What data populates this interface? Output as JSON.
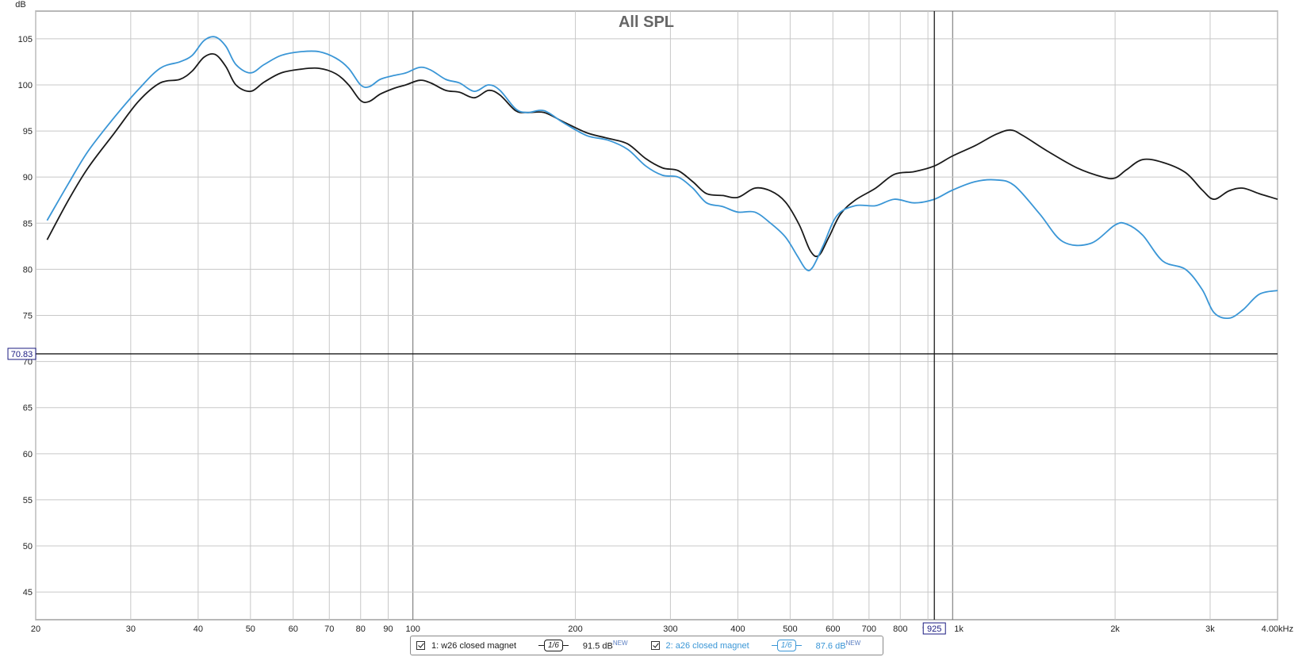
{
  "chart_data": {
    "type": "line",
    "title": "All SPL",
    "ylabel": "dB",
    "xscale": "log",
    "xlim": [
      20,
      4000
    ],
    "ylim": [
      42,
      108
    ],
    "x_ticks": [
      {
        "value": 20,
        "label": "20"
      },
      {
        "value": 30,
        "label": "30"
      },
      {
        "value": 40,
        "label": "40"
      },
      {
        "value": 50,
        "label": "50"
      },
      {
        "value": 60,
        "label": "60"
      },
      {
        "value": 70,
        "label": "70"
      },
      {
        "value": 80,
        "label": "80"
      },
      {
        "value": 90,
        "label": "90"
      },
      {
        "value": 100,
        "label": "100"
      },
      {
        "value": 200,
        "label": "200"
      },
      {
        "value": 300,
        "label": "300"
      },
      {
        "value": 400,
        "label": "400"
      },
      {
        "value": 500,
        "label": "500"
      },
      {
        "value": 600,
        "label": "600"
      },
      {
        "value": 700,
        "label": "700"
      },
      {
        "value": 800,
        "label": "800"
      },
      {
        "value": 900,
        "label": "9"
      },
      {
        "value": 1000,
        "label": "1k"
      },
      {
        "value": 2000,
        "label": "2k"
      },
      {
        "value": 3000,
        "label": "3k"
      },
      {
        "value": 4000,
        "label": "4.00kHz"
      }
    ],
    "y_ticks": [
      45,
      50,
      55,
      60,
      65,
      70,
      75,
      80,
      85,
      90,
      95,
      100,
      105
    ],
    "grid": true,
    "cursor": {
      "x": 925,
      "x_label": "925",
      "y": 70.83,
      "y_label": "70.83"
    },
    "series": [
      {
        "name": "1: w26 closed magnet",
        "color": "#1a1a1a",
        "points": [
          [
            21,
            83.2
          ],
          [
            23,
            87.5
          ],
          [
            25,
            91.0
          ],
          [
            28,
            94.8
          ],
          [
            31,
            98.2
          ],
          [
            34,
            100.2
          ],
          [
            37,
            100.6
          ],
          [
            39,
            101.5
          ],
          [
            41,
            103.0
          ],
          [
            43,
            103.3
          ],
          [
            45,
            102.0
          ],
          [
            47,
            100.0
          ],
          [
            50,
            99.3
          ],
          [
            53,
            100.3
          ],
          [
            57,
            101.3
          ],
          [
            62,
            101.7
          ],
          [
            67,
            101.8
          ],
          [
            72,
            101.2
          ],
          [
            76,
            100.0
          ],
          [
            80,
            98.3
          ],
          [
            83,
            98.2
          ],
          [
            87,
            99.0
          ],
          [
            92,
            99.6
          ],
          [
            97,
            100.0
          ],
          [
            103,
            100.5
          ],
          [
            108,
            100.2
          ],
          [
            115,
            99.4
          ],
          [
            122,
            99.2
          ],
          [
            130,
            98.6
          ],
          [
            138,
            99.4
          ],
          [
            145,
            98.9
          ],
          [
            155,
            97.2
          ],
          [
            163,
            97.0
          ],
          [
            175,
            97.0
          ],
          [
            190,
            96.0
          ],
          [
            210,
            94.8
          ],
          [
            230,
            94.2
          ],
          [
            250,
            93.6
          ],
          [
            270,
            92.0
          ],
          [
            290,
            91.0
          ],
          [
            310,
            90.7
          ],
          [
            330,
            89.5
          ],
          [
            350,
            88.2
          ],
          [
            375,
            88.0
          ],
          [
            400,
            87.8
          ],
          [
            430,
            88.8
          ],
          [
            460,
            88.5
          ],
          [
            490,
            87.3
          ],
          [
            520,
            84.8
          ],
          [
            545,
            82.0
          ],
          [
            565,
            81.5
          ],
          [
            590,
            83.5
          ],
          [
            620,
            86.0
          ],
          [
            660,
            87.5
          ],
          [
            720,
            88.8
          ],
          [
            780,
            90.3
          ],
          [
            850,
            90.6
          ],
          [
            925,
            91.2
          ],
          [
            1000,
            92.3
          ],
          [
            1100,
            93.4
          ],
          [
            1200,
            94.6
          ],
          [
            1280,
            95.1
          ],
          [
            1350,
            94.5
          ],
          [
            1500,
            92.8
          ],
          [
            1700,
            91.0
          ],
          [
            1900,
            90.0
          ],
          [
            2000,
            89.9
          ],
          [
            2100,
            90.8
          ],
          [
            2250,
            91.9
          ],
          [
            2450,
            91.6
          ],
          [
            2700,
            90.5
          ],
          [
            2900,
            88.6
          ],
          [
            3050,
            87.6
          ],
          [
            3250,
            88.5
          ],
          [
            3450,
            88.8
          ],
          [
            3700,
            88.2
          ],
          [
            4000,
            87.6
          ]
        ]
      },
      {
        "name": "2: a26 closed magnet",
        "color": "#3a96d6",
        "points": [
          [
            21,
            85.3
          ],
          [
            23,
            89.3
          ],
          [
            25,
            92.8
          ],
          [
            28,
            96.5
          ],
          [
            31,
            99.5
          ],
          [
            34,
            101.8
          ],
          [
            37,
            102.5
          ],
          [
            39,
            103.2
          ],
          [
            41,
            104.8
          ],
          [
            43,
            105.2
          ],
          [
            45,
            104.2
          ],
          [
            47,
            102.2
          ],
          [
            50,
            101.3
          ],
          [
            53,
            102.2
          ],
          [
            57,
            103.2
          ],
          [
            62,
            103.6
          ],
          [
            67,
            103.6
          ],
          [
            72,
            102.9
          ],
          [
            76,
            101.8
          ],
          [
            80,
            100.0
          ],
          [
            83,
            99.8
          ],
          [
            87,
            100.6
          ],
          [
            92,
            101.0
          ],
          [
            97,
            101.3
          ],
          [
            103,
            101.9
          ],
          [
            108,
            101.6
          ],
          [
            115,
            100.6
          ],
          [
            122,
            100.2
          ],
          [
            130,
            99.3
          ],
          [
            138,
            100.0
          ],
          [
            145,
            99.4
          ],
          [
            155,
            97.4
          ],
          [
            163,
            97.0
          ],
          [
            175,
            97.2
          ],
          [
            190,
            95.9
          ],
          [
            210,
            94.5
          ],
          [
            230,
            94.0
          ],
          [
            250,
            93.0
          ],
          [
            270,
            91.2
          ],
          [
            290,
            90.2
          ],
          [
            310,
            90.0
          ],
          [
            330,
            88.8
          ],
          [
            350,
            87.2
          ],
          [
            375,
            86.8
          ],
          [
            400,
            86.2
          ],
          [
            430,
            86.2
          ],
          [
            460,
            85.0
          ],
          [
            490,
            83.5
          ],
          [
            515,
            81.5
          ],
          [
            535,
            80.0
          ],
          [
            550,
            80.2
          ],
          [
            575,
            82.5
          ],
          [
            610,
            85.8
          ],
          [
            660,
            86.9
          ],
          [
            720,
            86.9
          ],
          [
            780,
            87.6
          ],
          [
            850,
            87.2
          ],
          [
            925,
            87.6
          ],
          [
            1000,
            88.6
          ],
          [
            1100,
            89.5
          ],
          [
            1200,
            89.7
          ],
          [
            1300,
            89.1
          ],
          [
            1450,
            86.0
          ],
          [
            1600,
            83.0
          ],
          [
            1800,
            82.8
          ],
          [
            2000,
            84.8
          ],
          [
            2100,
            84.9
          ],
          [
            2250,
            83.7
          ],
          [
            2450,
            80.9
          ],
          [
            2700,
            80.0
          ],
          [
            2900,
            77.8
          ],
          [
            3050,
            75.3
          ],
          [
            3250,
            74.7
          ],
          [
            3450,
            75.6
          ],
          [
            3700,
            77.3
          ],
          [
            4000,
            77.7
          ]
        ]
      }
    ]
  },
  "legend": {
    "items": [
      {
        "label": "1: w26 closed magnet",
        "smoothing": "1/6",
        "level": "91.5 dB",
        "badge": "NEW",
        "color": "#1a1a1a",
        "checked": true
      },
      {
        "label": "2: a26 closed magnet",
        "smoothing": "1/6",
        "level": "87.6 dB",
        "badge": "NEW",
        "color": "#3a96d6",
        "checked": true
      }
    ]
  }
}
